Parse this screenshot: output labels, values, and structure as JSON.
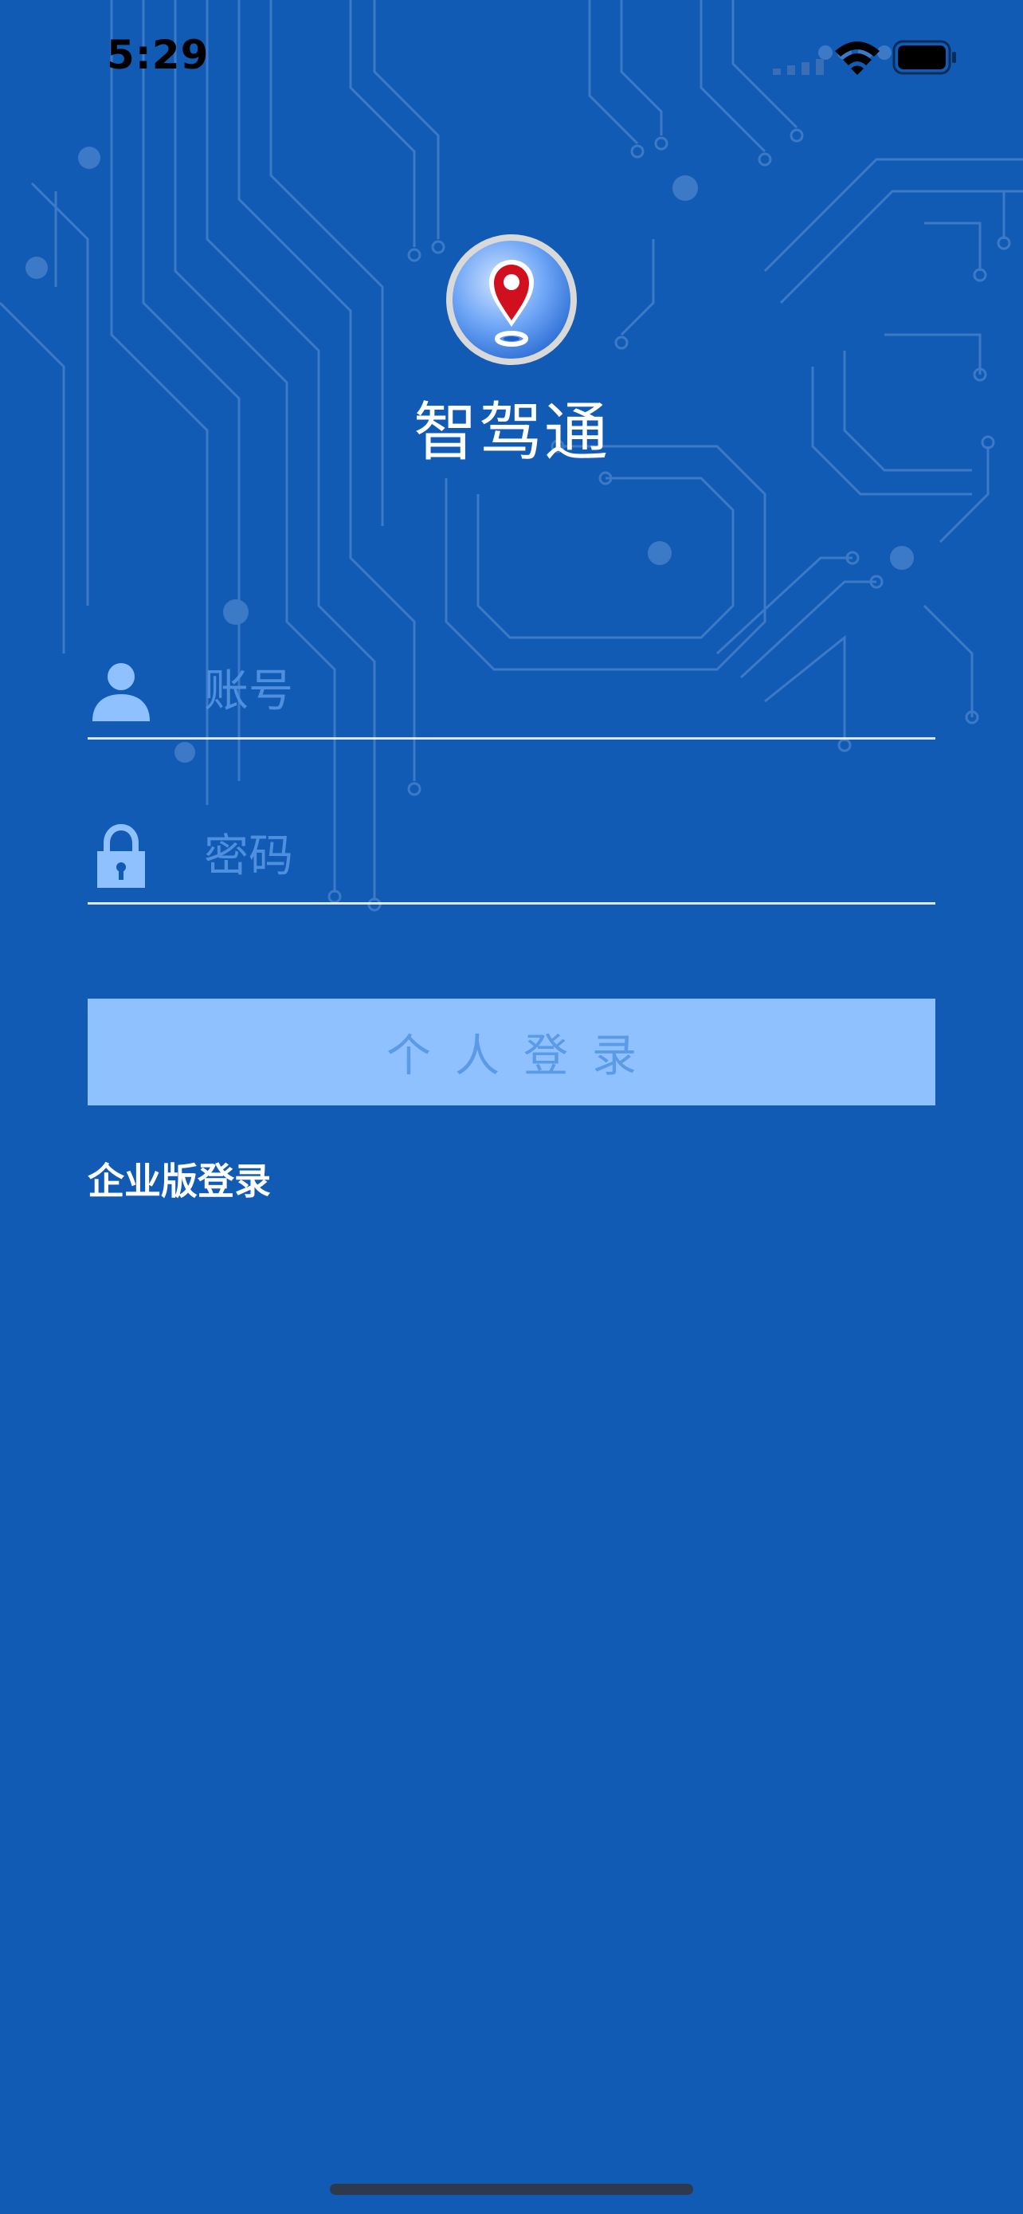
{
  "status_bar": {
    "time": "5:29",
    "icons": [
      "signal-icon",
      "wifi-icon",
      "battery-icon"
    ]
  },
  "app": {
    "name": "智驾通",
    "logo_icon": "location-pin-icon"
  },
  "login_form": {
    "account_placeholder": "账号",
    "account_value": "",
    "account_icon": "user-icon",
    "password_placeholder": "密码",
    "password_value": "",
    "password_icon": "lock-icon",
    "login_button_label": "个人登录",
    "enterprise_link": "企业版登录"
  },
  "colors": {
    "background": "#125bb4",
    "button_background": "#8fc0ff",
    "button_text": "#5b9ae6",
    "placeholder": "#4e8fdf",
    "pin_red": "#d0101e"
  }
}
